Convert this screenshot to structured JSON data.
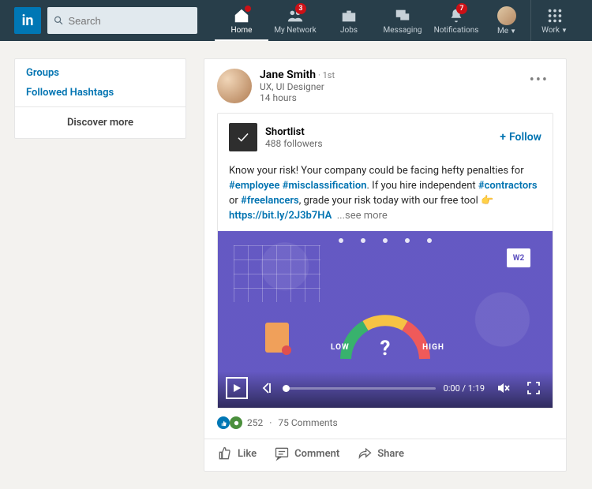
{
  "search": {
    "placeholder": "Search"
  },
  "nav": {
    "home": {
      "label": "Home",
      "badge": ""
    },
    "network": {
      "label": "My Network",
      "badge": "3"
    },
    "jobs": {
      "label": "Jobs",
      "badge": ""
    },
    "messaging": {
      "label": "Messaging",
      "badge": ""
    },
    "notifications": {
      "label": "Notifications",
      "badge": "7"
    },
    "me": {
      "label": "Me"
    },
    "work": {
      "label": "Work"
    }
  },
  "sidebar": {
    "groups": "Groups",
    "hashtags": "Followed Hashtags",
    "discover": "Discover more"
  },
  "post": {
    "author": {
      "name": "Jane Smith",
      "degree": "1st",
      "headline": "UX, UI Designer",
      "age": "14 hours"
    },
    "shared": {
      "name": "Shortlist",
      "followers": "488 followers",
      "follow": "Follow",
      "text_lead": "Know your risk! Your company could be facing hefty penalties for ",
      "tag1": "#employee",
      "tag2": "#misclassification",
      "text_mid1": ". If you hire independent ",
      "tag3": "#contractors",
      "text_mid2": " or ",
      "tag4": "#freelancers",
      "text_mid3": ", grade your risk today with our free tool 👉 ",
      "link": "https://bit.ly/2J3b7HA",
      "see_more": "...see more"
    },
    "video": {
      "gauge_low": "LOW",
      "gauge_high": "HIGH",
      "w2": "W2",
      "time": "0:00 / 1:19"
    },
    "reactions": {
      "count": "252",
      "comments": "75 Comments"
    },
    "actions": {
      "like": "Like",
      "comment": "Comment",
      "share": "Share"
    }
  }
}
